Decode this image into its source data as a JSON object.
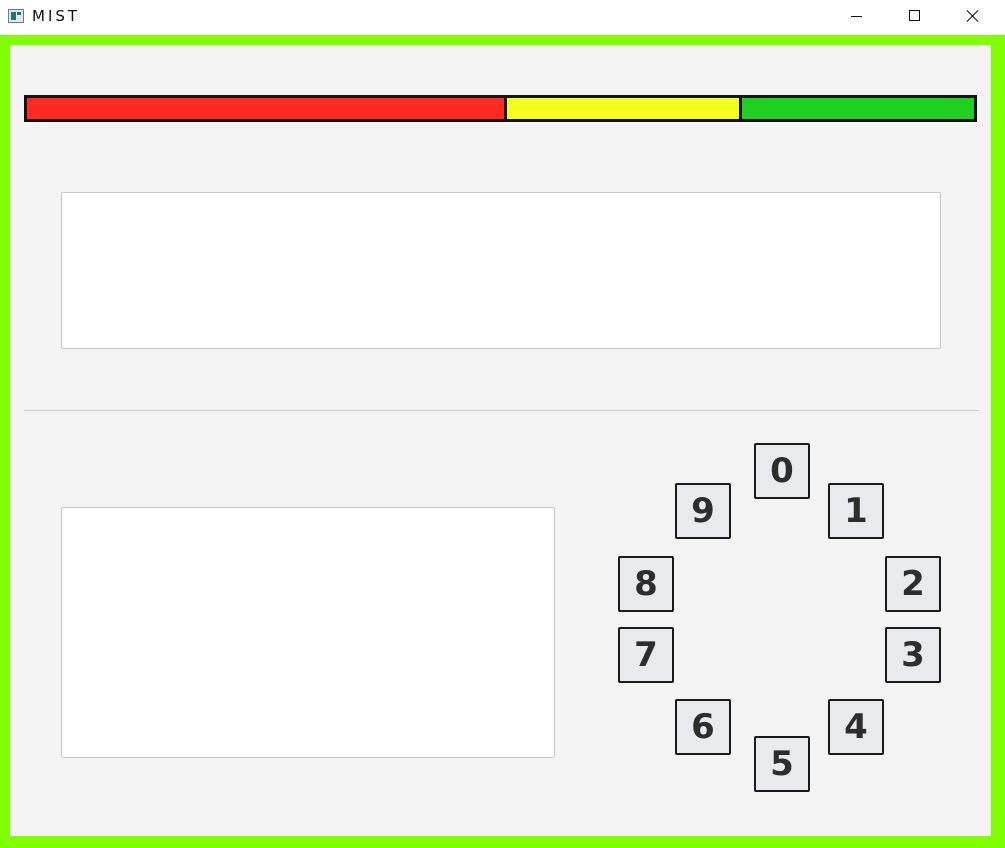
{
  "window": {
    "title": "MIST",
    "icon": "app-window-icon",
    "controls": [
      "minimize-icon",
      "maximize-icon",
      "close-icon"
    ]
  },
  "theme": {
    "frame_color": "#80ff00",
    "background": "#f3f3f3"
  },
  "level_bar": {
    "segments": [
      {
        "name": "red",
        "color": "#ff2a22",
        "fraction": 0.5
      },
      {
        "name": "yellow",
        "color": "#f0ff1e",
        "fraction": 0.25
      },
      {
        "name": "green",
        "color": "#20d020",
        "fraction": 0.25
      }
    ]
  },
  "top_text": "",
  "bottom_text": "",
  "keypad": {
    "keys": [
      "0",
      "1",
      "2",
      "3",
      "4",
      "5",
      "6",
      "7",
      "8",
      "9"
    ]
  }
}
